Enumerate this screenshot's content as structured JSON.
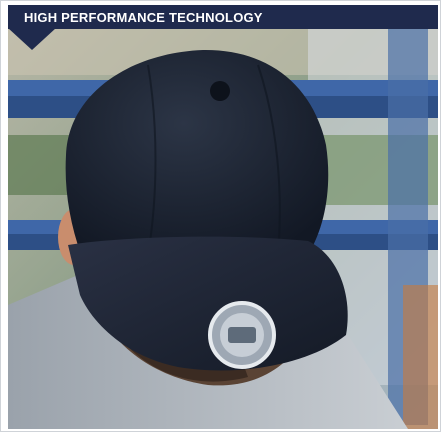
{
  "banner": {
    "title": "HIGH PERFORMANCE TECHNOLOGY"
  },
  "photo": {
    "subject": "man-wearing-navy-snapback-cap",
    "cap_color": "#1c2433",
    "background_accent": "#3f67a8"
  },
  "colors": {
    "banner_bg": "#1f2a4d",
    "banner_text": "#ffffff"
  }
}
